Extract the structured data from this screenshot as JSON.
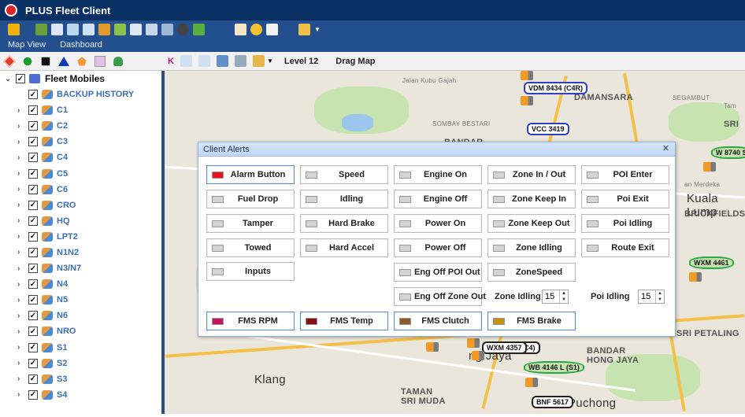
{
  "app": {
    "title": "PLUS Fleet Client"
  },
  "menu": {
    "items": [
      "Map View",
      "Dashboard"
    ]
  },
  "map_toolbar": {
    "level": "Level 12",
    "drag_map": "Drag Map"
  },
  "tree": {
    "root": "Fleet Mobiles",
    "items": [
      "BACKUP HISTORY",
      "C1",
      "C2",
      "C3",
      "C4",
      "C5",
      "C6",
      "CRO",
      "HQ",
      "LPT2",
      "N1N2",
      "N3/N7",
      "N4",
      "N5",
      "N6",
      "NRO",
      "S1",
      "S2",
      "S3",
      "S4"
    ]
  },
  "dialog": {
    "title": "Client Alerts",
    "alerts": {
      "alarm_button": "Alarm Button",
      "speed": "Speed",
      "engine_on": "Engine On",
      "zone_in_out": "Zone In / Out",
      "poi_enter": "POI Enter",
      "fuel_drop": "Fuel Drop",
      "idling": "Idling",
      "engine_off": "Engine Off",
      "zone_keep_in": "Zone Keep In",
      "poi_exit": "Poi Exit",
      "tamper": "Tamper",
      "hard_brake": "Hard Brake",
      "power_on": "Power On",
      "zone_keep_out": "Zone Keep Out",
      "poi_idling": "Poi Idling",
      "towed": "Towed",
      "hard_accel": "Hard Accel",
      "power_off": "Power Off",
      "zone_idling": "Zone Idling",
      "route_exit": "Route Exit",
      "inputs": "Inputs",
      "eng_off_poi_out": "Eng Off POI Out",
      "zone_speed": "ZoneSpeed",
      "eng_off_zone_out": "Eng Off Zone Out",
      "fms_rpm": "FMS RPM",
      "fms_temp": "FMS Temp",
      "fms_clutch": "FMS Clutch",
      "fms_brake": "FMS Brake"
    },
    "zone_idling_label": "Zone Idling",
    "zone_idling_value": "15",
    "poi_idling_label": "Poi Idling",
    "poi_idling_value": "15"
  },
  "colors": {
    "alarm": "#e8141c",
    "fms_rpm": "#c4155e",
    "fms_temp": "#8a0d12",
    "fms_clutch": "#8d5a2b",
    "fms_brake": "#c4920a"
  },
  "map": {
    "labels": {
      "damansara": "DAMANSARA",
      "bandar": "BANDAR",
      "kuala_lumpur": "Kuala Lump",
      "brickfields": "BRICKFIELDS",
      "sri_petaling": "SRI PETALING",
      "klang": "Klang",
      "puchong": "Puchong",
      "bandar_hong_jaya": "BANDAR\nHONG JAYA",
      "taman_sri_muda": "TAMAN\nSRI MUDA",
      "ng_jaya": "ng Jaya",
      "sombay_bestari": "SOMBAY BESTARI",
      "jalan_kubu_gajah": "Jalan Kubu Gajah",
      "segambut": "SEGAMBUT",
      "merdeka": "an Merdeka",
      "taman": "Tam",
      "sri": "SRI"
    },
    "vehicles": [
      {
        "label": "VDM 8434 (C4R)",
        "color": "blue"
      },
      {
        "label": "VCC 3419",
        "color": "blue"
      },
      {
        "label": "W 8740 S",
        "color": "green"
      },
      {
        "label": "WXM 4461",
        "color": "green"
      },
      {
        "label": "WXM 4357",
        "color": "black"
      },
      {
        "label": "EC4)",
        "color": "black"
      },
      {
        "label": "WB 4146 L (S1)",
        "color": "green"
      },
      {
        "label": "BNF 5617",
        "color": "black"
      }
    ]
  }
}
